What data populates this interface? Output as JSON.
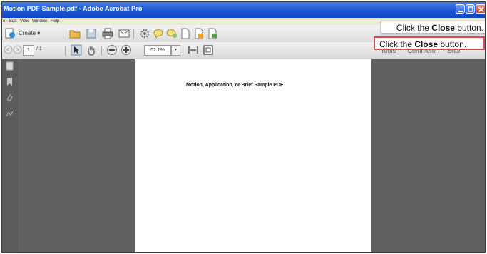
{
  "window": {
    "title": "Motion PDF Sample.pdf - Adobe Acrobat Pro"
  },
  "menubar": {
    "items": [
      "e",
      "Edit",
      "View",
      "Window",
      "Help"
    ]
  },
  "toolbar": {
    "create_label": "Create",
    "create_arrow": "▾"
  },
  "navbar": {
    "current_page": "1",
    "page_count": "/ 1",
    "zoom": "52.1%",
    "zoom_arrow": "▾"
  },
  "right_panel_tabs": [
    "Tools",
    "Comment",
    "Shar"
  ],
  "document": {
    "heading": "Motion, Application, or Brief Sample PDF"
  },
  "callouts": [
    {
      "prefix": "Click the ",
      "bold": "Close",
      "suffix": " button."
    },
    {
      "prefix": "Click the ",
      "bold": "Close",
      "suffix": " button."
    }
  ],
  "colors": {
    "titlebar": "#1b56d4",
    "workspace": "#616161",
    "callout_border": "#e04a4a"
  }
}
